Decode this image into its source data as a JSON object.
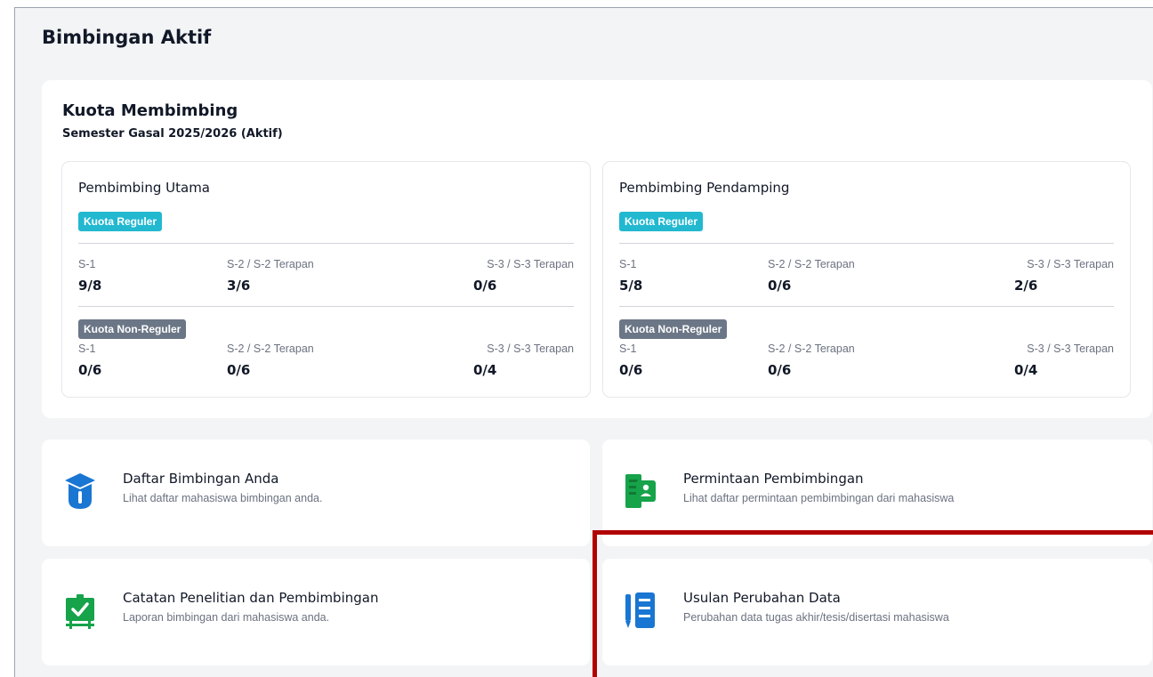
{
  "page": {
    "title": "Bimbingan Aktif"
  },
  "quota": {
    "title": "Kuota Membimbing",
    "semester": "Semester Gasal 2025/2026 (Aktif)",
    "panels": [
      {
        "title": "Pembimbing Utama",
        "regular_badge": "Kuota Reguler",
        "regular": [
          {
            "label": "S-1",
            "value": "9/8"
          },
          {
            "label": "S-2 / S-2 Terapan",
            "value": "3/6"
          },
          {
            "label": "S-3 / S-3 Terapan",
            "value": "0/6"
          }
        ],
        "nonregular_badge": "Kuota Non-Reguler",
        "nonregular": [
          {
            "label": "S-1",
            "value": "0/6"
          },
          {
            "label": "S-2 / S-2 Terapan",
            "value": "0/6"
          },
          {
            "label": "S-3 / S-3 Terapan",
            "value": "0/4"
          }
        ]
      },
      {
        "title": "Pembimbing Pendamping",
        "regular_badge": "Kuota Reguler",
        "regular": [
          {
            "label": "S-1",
            "value": "5/8"
          },
          {
            "label": "S-2 / S-2 Terapan",
            "value": "0/6"
          },
          {
            "label": "S-3 / S-3 Terapan",
            "value": "2/6"
          }
        ],
        "nonregular_badge": "Kuota Non-Reguler",
        "nonregular": [
          {
            "label": "S-1",
            "value": "0/6"
          },
          {
            "label": "S-2 / S-2 Terapan",
            "value": "0/6"
          },
          {
            "label": "S-3 / S-3 Terapan",
            "value": "0/4"
          }
        ]
      }
    ]
  },
  "menu": [
    {
      "title": "Daftar Bimbingan Anda",
      "desc": "Lihat daftar mahasiswa bimbingan anda.",
      "icon": "graduation-cap-icon"
    },
    {
      "title": "Permintaan Pembimbingan",
      "desc": "Lihat daftar permintaan pembimbingan dari mahasiswa",
      "icon": "student-request-icon"
    },
    {
      "title": "Catatan Penelitian dan Pembimbingan",
      "desc": "Laporan bimbingan dari mahasiswa anda.",
      "icon": "presentation-board-icon"
    },
    {
      "title": "Usulan Perubahan Data",
      "desc": "Perubahan data tugas akhir/tesis/disertasi mahasiswa",
      "icon": "edit-document-icon"
    }
  ],
  "colors": {
    "badge_regular": "#22b8d0",
    "badge_nonregular": "#6b7686",
    "icon_blue": "#1976d2",
    "icon_green": "#16a34a",
    "highlight": "#b00000"
  }
}
